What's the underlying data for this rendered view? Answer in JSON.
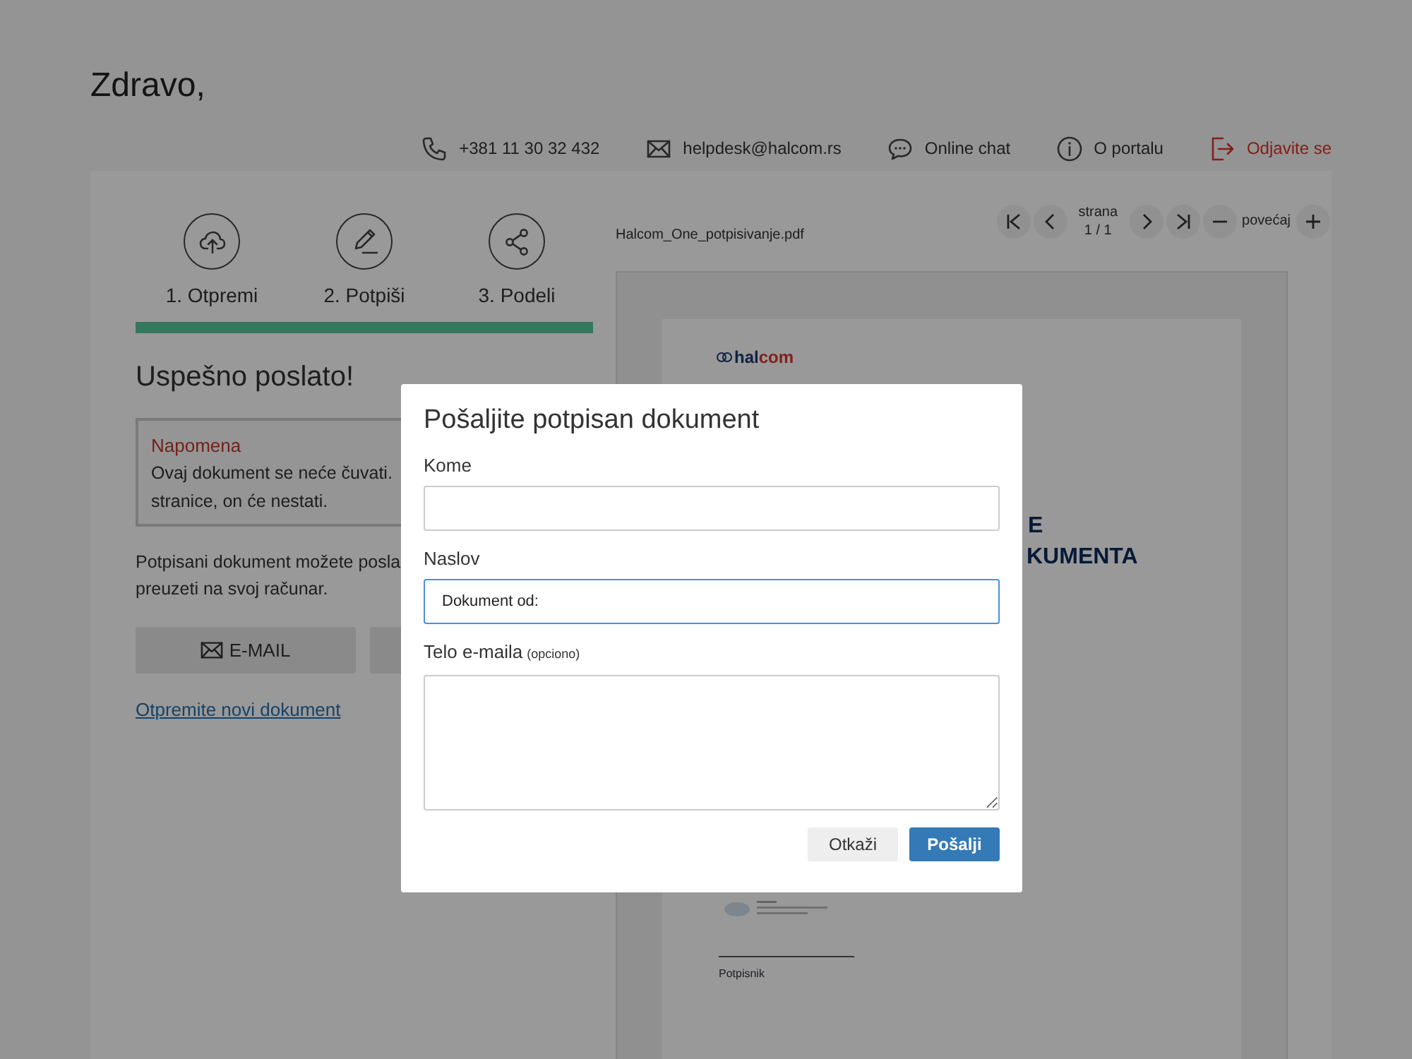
{
  "greeting": "Zdravo,",
  "contact_bar": [
    {
      "kind": "phone",
      "label": "+381 11 30 32 432"
    },
    {
      "kind": "mail",
      "label": "helpdesk@halcom.rs"
    },
    {
      "kind": "chat",
      "label": "Online chat"
    },
    {
      "kind": "info",
      "label": "O portalu"
    },
    {
      "kind": "logout",
      "label": "Odjavite se"
    }
  ],
  "steps": [
    {
      "kind": "upload",
      "label": "1. Otpremi"
    },
    {
      "kind": "sign",
      "label": "2. Potpiši"
    },
    {
      "kind": "share",
      "label": "3. Podeli"
    }
  ],
  "progress": {
    "level": 1
  },
  "success_title": "Uspešno poslato!",
  "note": {
    "title": "Napomena",
    "lines": [
      "Ovaj dokument se neće čuvati.",
      "stranice, on će nestati."
    ]
  },
  "info_lines": [
    "Potpisani dokument možete posla",
    "preuzeti na svoj računar."
  ],
  "action_buttons": [
    {
      "kind": "mail",
      "label": "E-MAIL"
    },
    {
      "kind": "other"
    }
  ],
  "new_document_link": "Otpremite novi dokument",
  "viewer": {
    "filename": "Halcom_One_potpisivanje.pdf",
    "page_label": "strana",
    "page_value": "1 / 1",
    "zoom_label": "povećaj",
    "document": {
      "logo": [
        "hal",
        "com"
      ],
      "heading_lines": [
        "E",
        "KUMENTA"
      ],
      "signer_label": "Potpisnik"
    }
  },
  "dialog": {
    "title": "Pošaljite potpisan dokument",
    "fields": [
      {
        "kind": "input",
        "label": "Kome",
        "focused": false
      },
      {
        "kind": "input",
        "label": "Naslov",
        "value": "Dokument od:",
        "focused": true
      },
      {
        "kind": "textarea",
        "label": "Telo e-maila",
        "hint": "(opciono)",
        "focused": false
      }
    ],
    "buttons": [
      {
        "kind": "secondary",
        "label": "Otkaži"
      },
      {
        "kind": "primary",
        "label": "Pošalji"
      }
    ]
  }
}
